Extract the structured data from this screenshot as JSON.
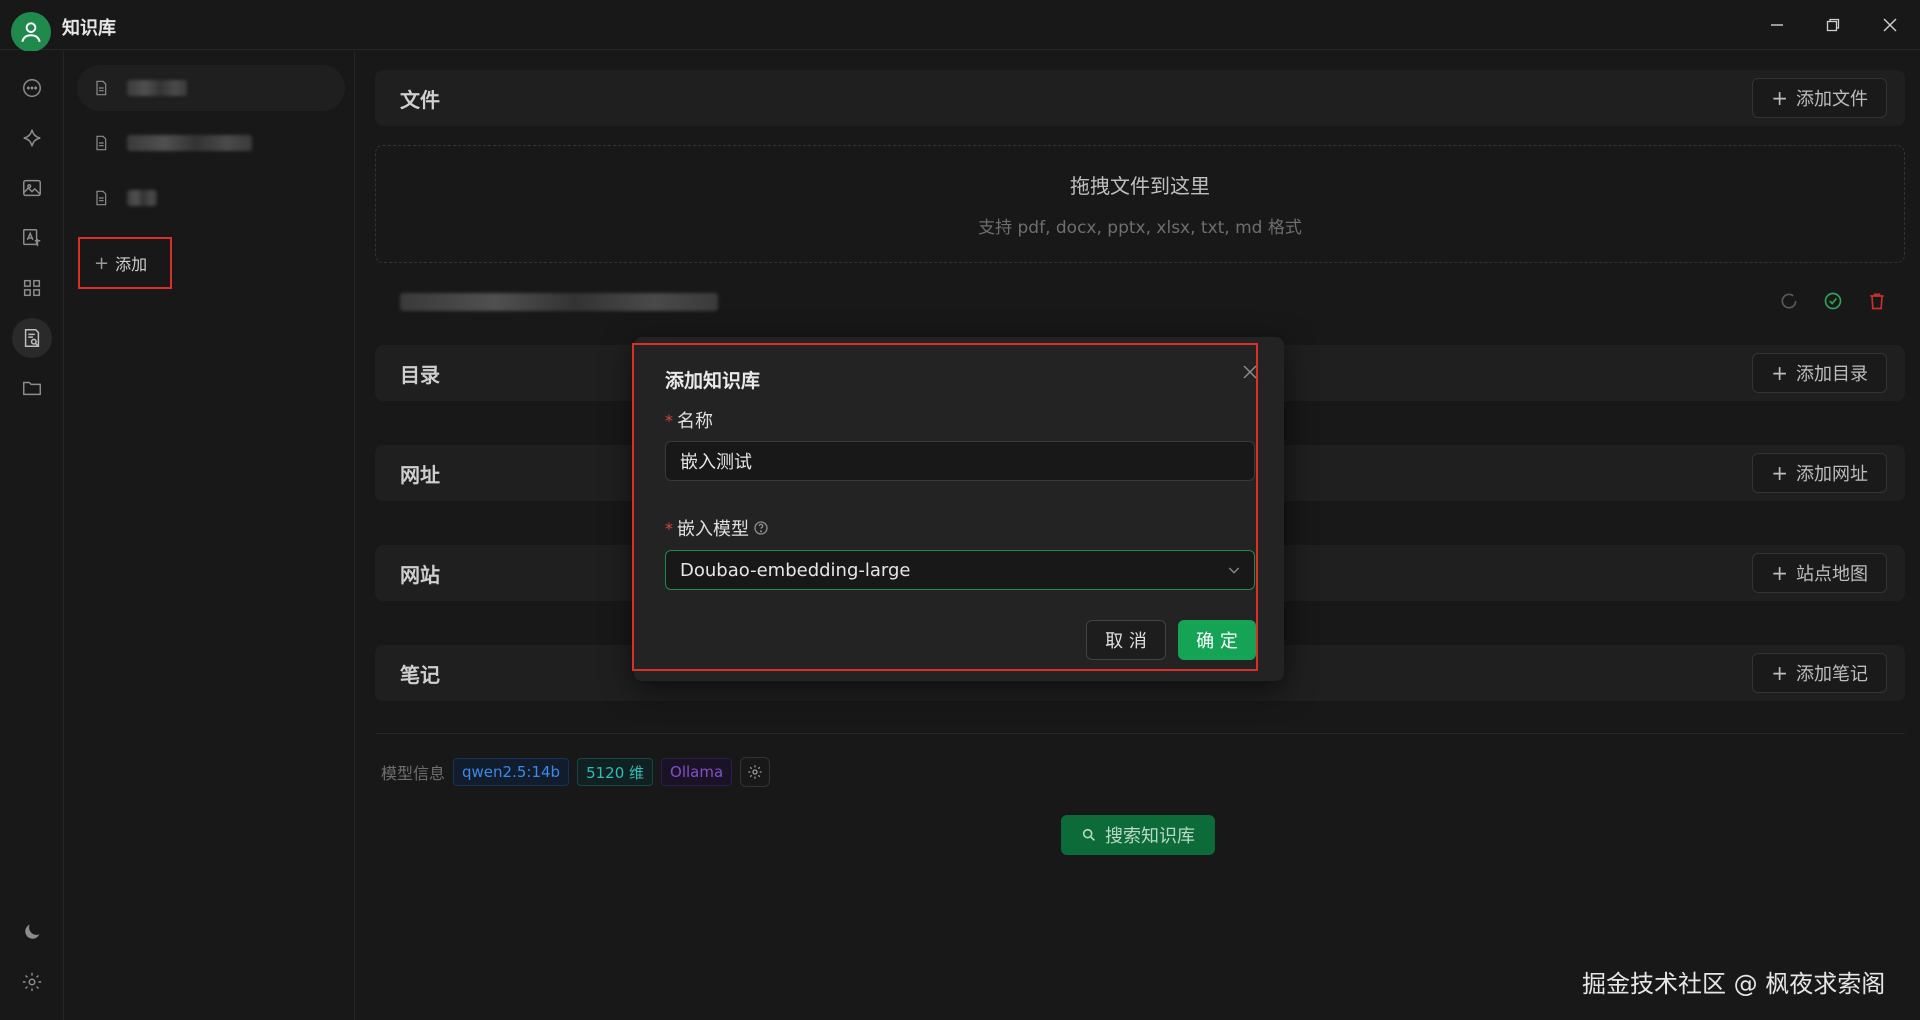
{
  "app": {
    "title": "知识库"
  },
  "window_controls": [
    "minimize-icon",
    "restore-icon",
    "close-icon"
  ],
  "rail": {
    "items": [
      "chat-icon",
      "sparkle-icon",
      "image-icon",
      "translate-icon",
      "apps-icon",
      "knowledge-icon",
      "folder-icon"
    ],
    "bottom": [
      "moon-icon",
      "gear-icon"
    ]
  },
  "kb_list": {
    "add_label": "添加"
  },
  "sections": {
    "files": {
      "title": "文件",
      "button": "添加文件"
    },
    "dropzone": {
      "title": "拖拽文件到这里",
      "subtitle": "支持 pdf, docx, pptx, xlsx, txt, md 格式"
    },
    "directory": {
      "title": "目录",
      "button": "添加目录"
    },
    "url": {
      "title": "网址",
      "button": "添加网址"
    },
    "website": {
      "title": "网站",
      "button": "站点地图"
    },
    "notes": {
      "title": "笔记",
      "button": "添加笔记"
    }
  },
  "model_info": {
    "label": "模型信息",
    "model": "qwen2.5:14b",
    "dims": "5120 维",
    "provider": "Ollama"
  },
  "search_button": "搜索知识库",
  "dialog": {
    "title": "添加知识库",
    "name_label": "名称",
    "name_value": "嵌入测试",
    "model_label": "嵌入模型",
    "model_value": "Doubao-embedding-large",
    "cancel": "取 消",
    "ok": "确 定"
  },
  "watermark": "掘金技术社区 @ 枫夜求索阁",
  "colors": {
    "accent": "#15a456",
    "highlight_border": "#d9302a",
    "background": "#181818"
  }
}
